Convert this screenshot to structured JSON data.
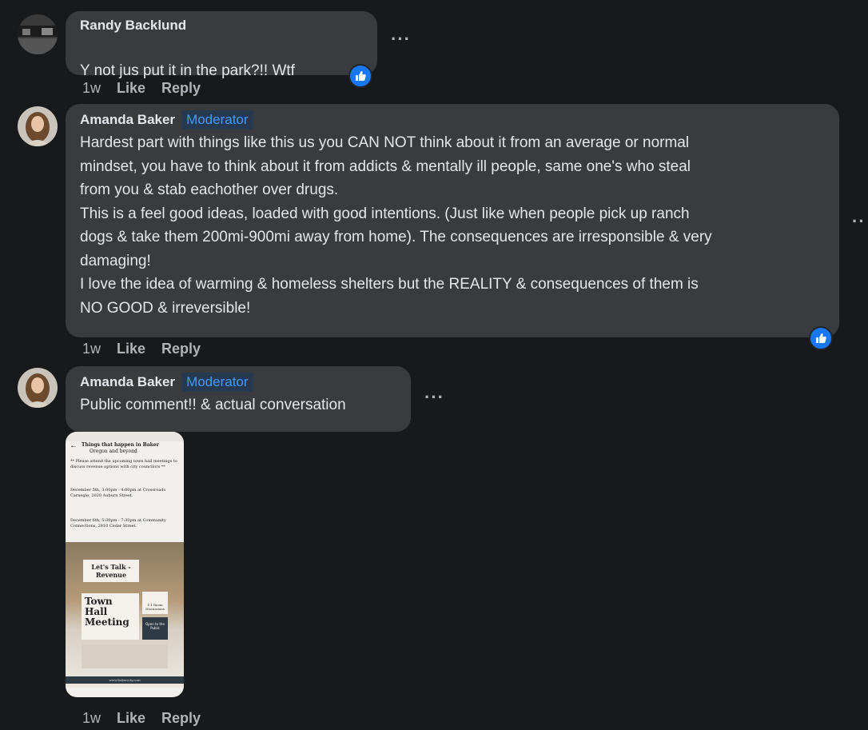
{
  "comments": [
    {
      "author": "Randy Backlund",
      "text": "Y not jus put it in the park?!! Wtf",
      "time": "1w",
      "like_label": "Like",
      "reply_label": "Reply",
      "more_icon": "more-horizontal-icon",
      "reaction_icon": "like-reaction-icon"
    },
    {
      "author": "Amanda Baker",
      "badge": "Moderator",
      "text": "Hardest part with things like this us you CAN NOT think about it from an average or normal\nmindset, you have to think about it from addicts & mentally ill people, same one's who steal\nfrom you & stab eachother over drugs.\nThis is a feel good ideas, loaded with good intentions. (Just like when people pick up ranch\ndogs & take them 200mi-900mi away from home). The consequences are irresponsible & very\ndamaging!\nI love the idea of warming & homeless shelters but the REALITY & consequences of them is\nNO GOOD & irreversible!",
      "time": "1w",
      "like_label": "Like",
      "reply_label": "Reply"
    },
    {
      "author": "Amanda Baker",
      "badge": "Moderator",
      "text": "Public comment!! & actual conversation",
      "time": "1w",
      "like_label": "Like",
      "reply_label": "Reply"
    }
  ],
  "attachment": {
    "header": "Things that happen in Baker",
    "subheader": "Oregon and beyond",
    "intro": "** Please attend the upcoming town hall meetings to discuss revenue options with city councilors **",
    "event1": "December 5th, 3:00pm - 4:00pm at Crossroads Carnegie, 2020 Auburn Street.",
    "event2": "December 6th, 5:30pm - 7:30pm at Community Connections, 2810 Cedar Street",
    "banner": "Let's Talk - Revenue",
    "title": "Town Hall Meeting",
    "side1": "1:1 Room Discussions",
    "side2": "Open to the Public",
    "footer": "www.bakercity.com"
  },
  "colors": {
    "background": "#18191a",
    "bubble": "#3a3b3c",
    "moderator_text": "#4599ff",
    "reaction_blue": "#1877f2"
  }
}
